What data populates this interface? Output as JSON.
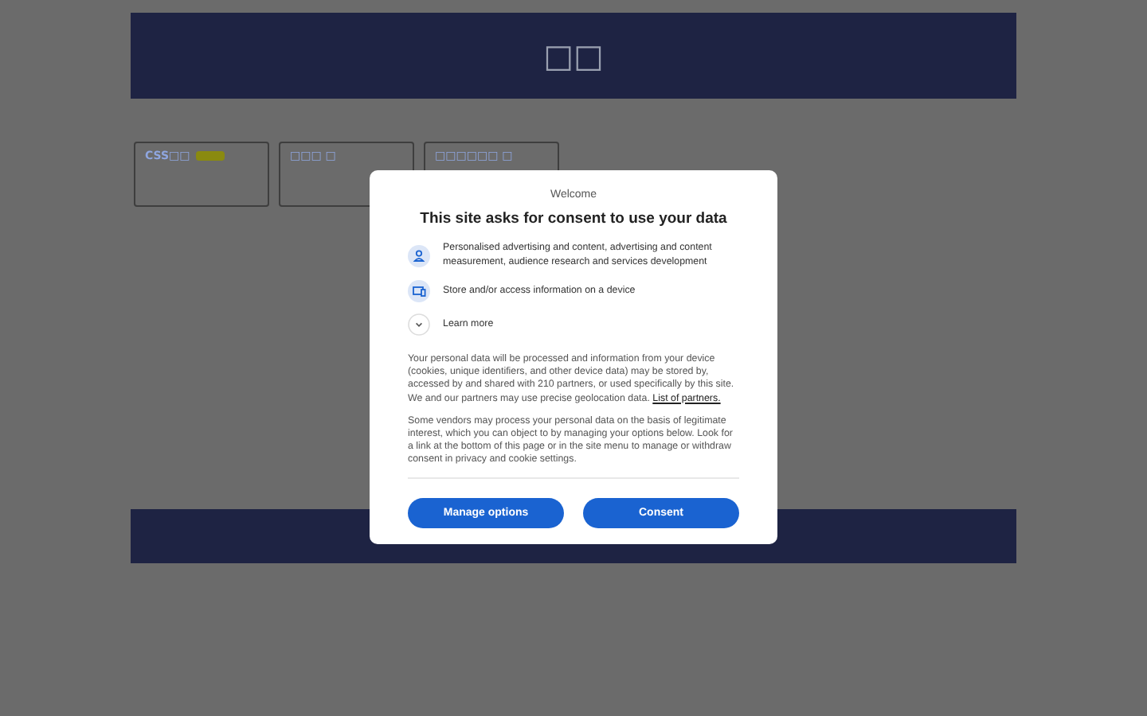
{
  "header": {
    "title": "□□"
  },
  "cards": [
    {
      "label": "CSS□□",
      "badge": true
    },
    {
      "label": "□□□ □",
      "badge": false
    },
    {
      "label": "□□□□□□ □",
      "badge": false
    }
  ],
  "dialog": {
    "welcome": "Welcome",
    "title": "This site asks for consent to use your data",
    "purposes": [
      {
        "kind": "person",
        "text": "Personalised advertising and content, advertising and content measurement, audience research and services development"
      },
      {
        "kind": "device",
        "text": "Store and/or access information on a device"
      },
      {
        "kind": "expand",
        "text": "Learn more"
      }
    ],
    "paragraph_1": "Your personal data will be processed and information from your device (cookies, unique identifiers, and other device data) may be stored by, accessed by and shared with 210 partners, or used specifically by this site. We and our partners may use precise geolocation data.",
    "partners_link": "List of partners.",
    "paragraph_2": "Some vendors may process your personal data on the basis of legitimate interest, which you can object to by managing your options below. Look for a link at the bottom of this page or in the site menu to manage or withdraw consent in privacy and cookie settings.",
    "buttons": [
      "Manage options",
      "Consent"
    ]
  }
}
